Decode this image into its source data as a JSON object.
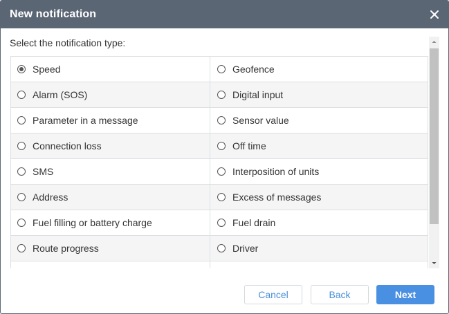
{
  "dialog": {
    "title": "New notification",
    "close_icon": "close-icon",
    "prompt": "Select the notification type:"
  },
  "options": [
    {
      "left": {
        "label": "Speed",
        "selected": true
      },
      "right": {
        "label": "Geofence",
        "selected": false
      }
    },
    {
      "left": {
        "label": "Alarm (SOS)",
        "selected": false
      },
      "right": {
        "label": "Digital input",
        "selected": false
      }
    },
    {
      "left": {
        "label": "Parameter in a message",
        "selected": false
      },
      "right": {
        "label": "Sensor value",
        "selected": false
      }
    },
    {
      "left": {
        "label": "Connection loss",
        "selected": false
      },
      "right": {
        "label": "Off time",
        "selected": false
      }
    },
    {
      "left": {
        "label": "SMS",
        "selected": false
      },
      "right": {
        "label": "Interposition of units",
        "selected": false
      }
    },
    {
      "left": {
        "label": "Address",
        "selected": false
      },
      "right": {
        "label": "Excess of messages",
        "selected": false
      }
    },
    {
      "left": {
        "label": "Fuel filling or battery charge",
        "selected": false
      },
      "right": {
        "label": "Fuel drain",
        "selected": false
      }
    },
    {
      "left": {
        "label": "Route progress",
        "selected": false
      },
      "right": {
        "label": "Driver",
        "selected": false
      }
    },
    {
      "left": {
        "label": "",
        "selected": false
      },
      "right": {
        "label": "",
        "selected": false
      }
    }
  ],
  "buttons": {
    "cancel": "Cancel",
    "back": "Back",
    "next": "Next"
  },
  "colors": {
    "header_bg": "#5b6675",
    "accent": "#4a90e2",
    "row_shade": "#f5f5f5"
  }
}
